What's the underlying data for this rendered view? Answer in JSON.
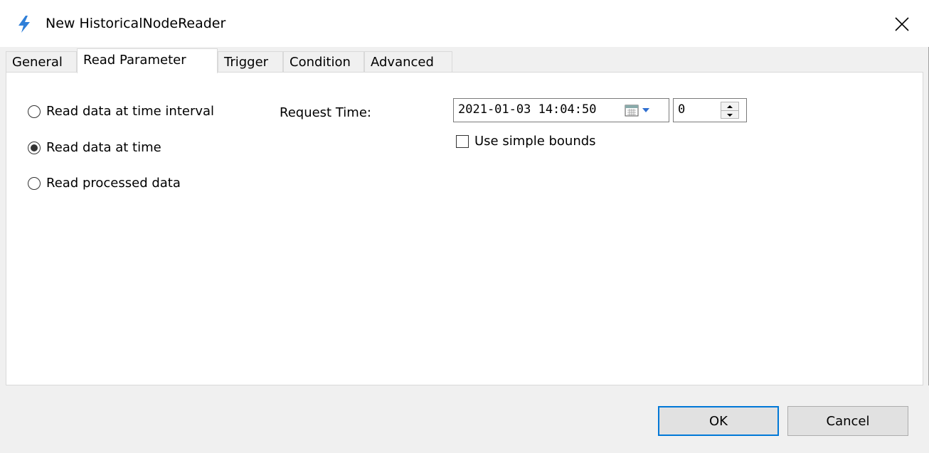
{
  "window": {
    "title": "New HistoricalNodeReader",
    "icon": "lightning-bolt-icon",
    "accent_color": "#0078d7"
  },
  "tabs": [
    {
      "label": "General",
      "active": false
    },
    {
      "label": "Read Parameter",
      "active": true
    },
    {
      "label": "Trigger",
      "active": false
    },
    {
      "label": "Condition",
      "active": false
    },
    {
      "label": "Advanced",
      "active": false
    }
  ],
  "read_mode": {
    "options": [
      {
        "label": "Read data at time interval",
        "checked": false
      },
      {
        "label": "Read data at time",
        "checked": true
      },
      {
        "label": "Read processed data",
        "checked": false
      }
    ]
  },
  "request_time": {
    "label": "Request Time:",
    "datetime_value": "2021-01-03 14:04:50",
    "spin_value": "0"
  },
  "simple_bounds": {
    "label": "Use simple bounds",
    "checked": false
  },
  "buttons": {
    "ok_label": "OK",
    "cancel_label": "Cancel"
  }
}
